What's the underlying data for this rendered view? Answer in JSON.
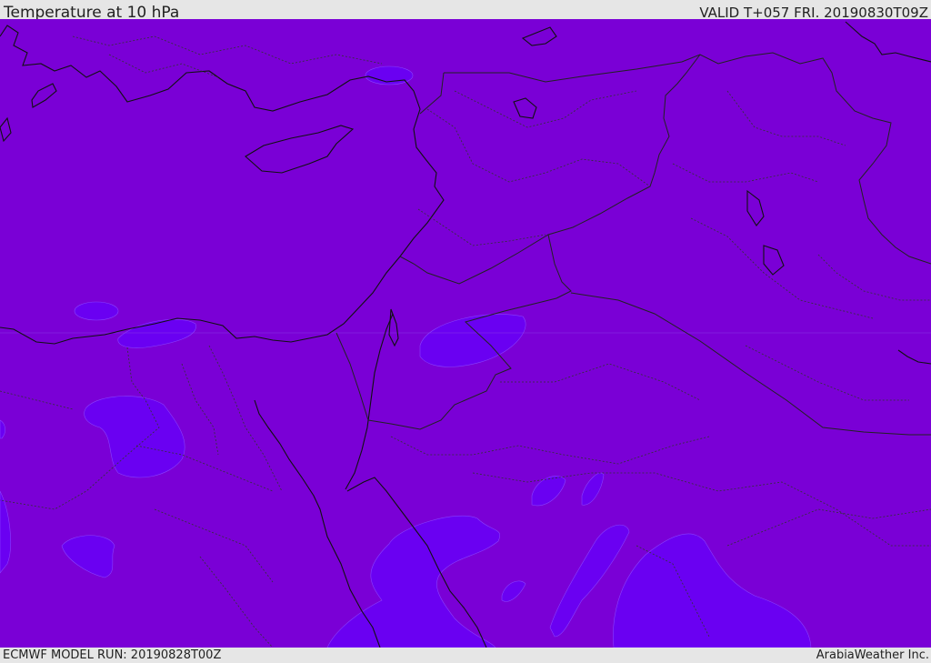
{
  "header": {
    "title": "Temperature at 10 hPa",
    "valid": "VALID T+057 FRI. 20190830T09Z"
  },
  "footer": {
    "model_run": "ECMWF MODEL RUN: 20190828T00Z",
    "credit": "ArabiaWeather Inc."
  },
  "map": {
    "parameter": "Temperature",
    "level": "10 hPa",
    "colors": {
      "base_field": "#7a00d6",
      "warm_patches": "#6a00f2",
      "coastline": "#111111",
      "borders": "#222222",
      "admin_borders": "#333333"
    }
  }
}
